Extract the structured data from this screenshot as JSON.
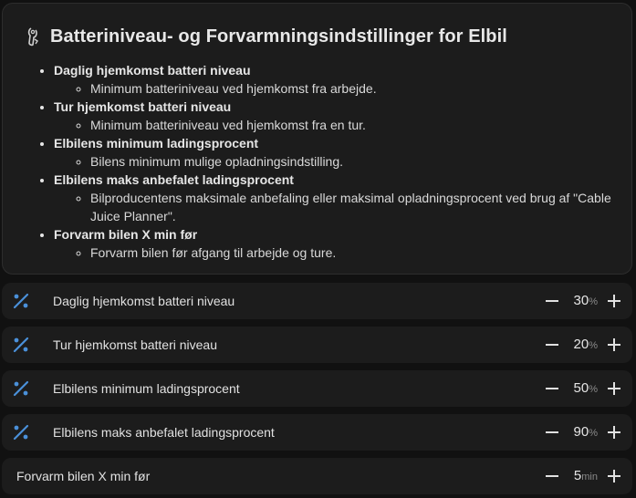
{
  "card": {
    "title": "Batteriniveau- og Forvarmningsindstillinger for Elbil",
    "icon": "car-battery-info-icon",
    "items": [
      {
        "heading": "Daglig hjemkomst batteri niveau",
        "text": "Minimum batteriniveau ved hjemkomst fra arbejde."
      },
      {
        "heading": "Tur hjemkomst batteri niveau",
        "text": "Minimum batteriniveau ved hjemkomst fra en tur."
      },
      {
        "heading": "Elbilens minimum ladingsprocent",
        "text": "Bilens minimum mulige opladningsindstilling."
      },
      {
        "heading": "Elbilens maks anbefalet ladingsprocent",
        "text": "Bilproducentens maksimale anbefaling eller maksimal opladningsprocent ved brug af \"Cable Juice Planner\"."
      },
      {
        "heading": "Forvarm bilen X min før",
        "text": "Forvarm bilen før afgang til arbejde og ture."
      }
    ]
  },
  "rows": [
    {
      "label": "Daglig hjemkomst batteri niveau",
      "value": "30",
      "unit": "%",
      "icon": "percent-icon"
    },
    {
      "label": "Tur hjemkomst batteri niveau",
      "value": "20",
      "unit": "%",
      "icon": "percent-icon"
    },
    {
      "label": "Elbilens minimum ladingsprocent",
      "value": "50",
      "unit": "%",
      "icon": "percent-icon"
    },
    {
      "label": "Elbilens maks anbefalet ladingsprocent",
      "value": "90",
      "unit": "%",
      "icon": "percent-icon"
    },
    {
      "label": "Forvarm bilen X min før",
      "value": "5",
      "unit": "min",
      "icon": ""
    }
  ],
  "colors": {
    "background": "#111111",
    "card": "#1c1c1c",
    "icon_blue": "#4a90d9",
    "text": "#e1e1e1",
    "unit": "#8a8a8a"
  }
}
